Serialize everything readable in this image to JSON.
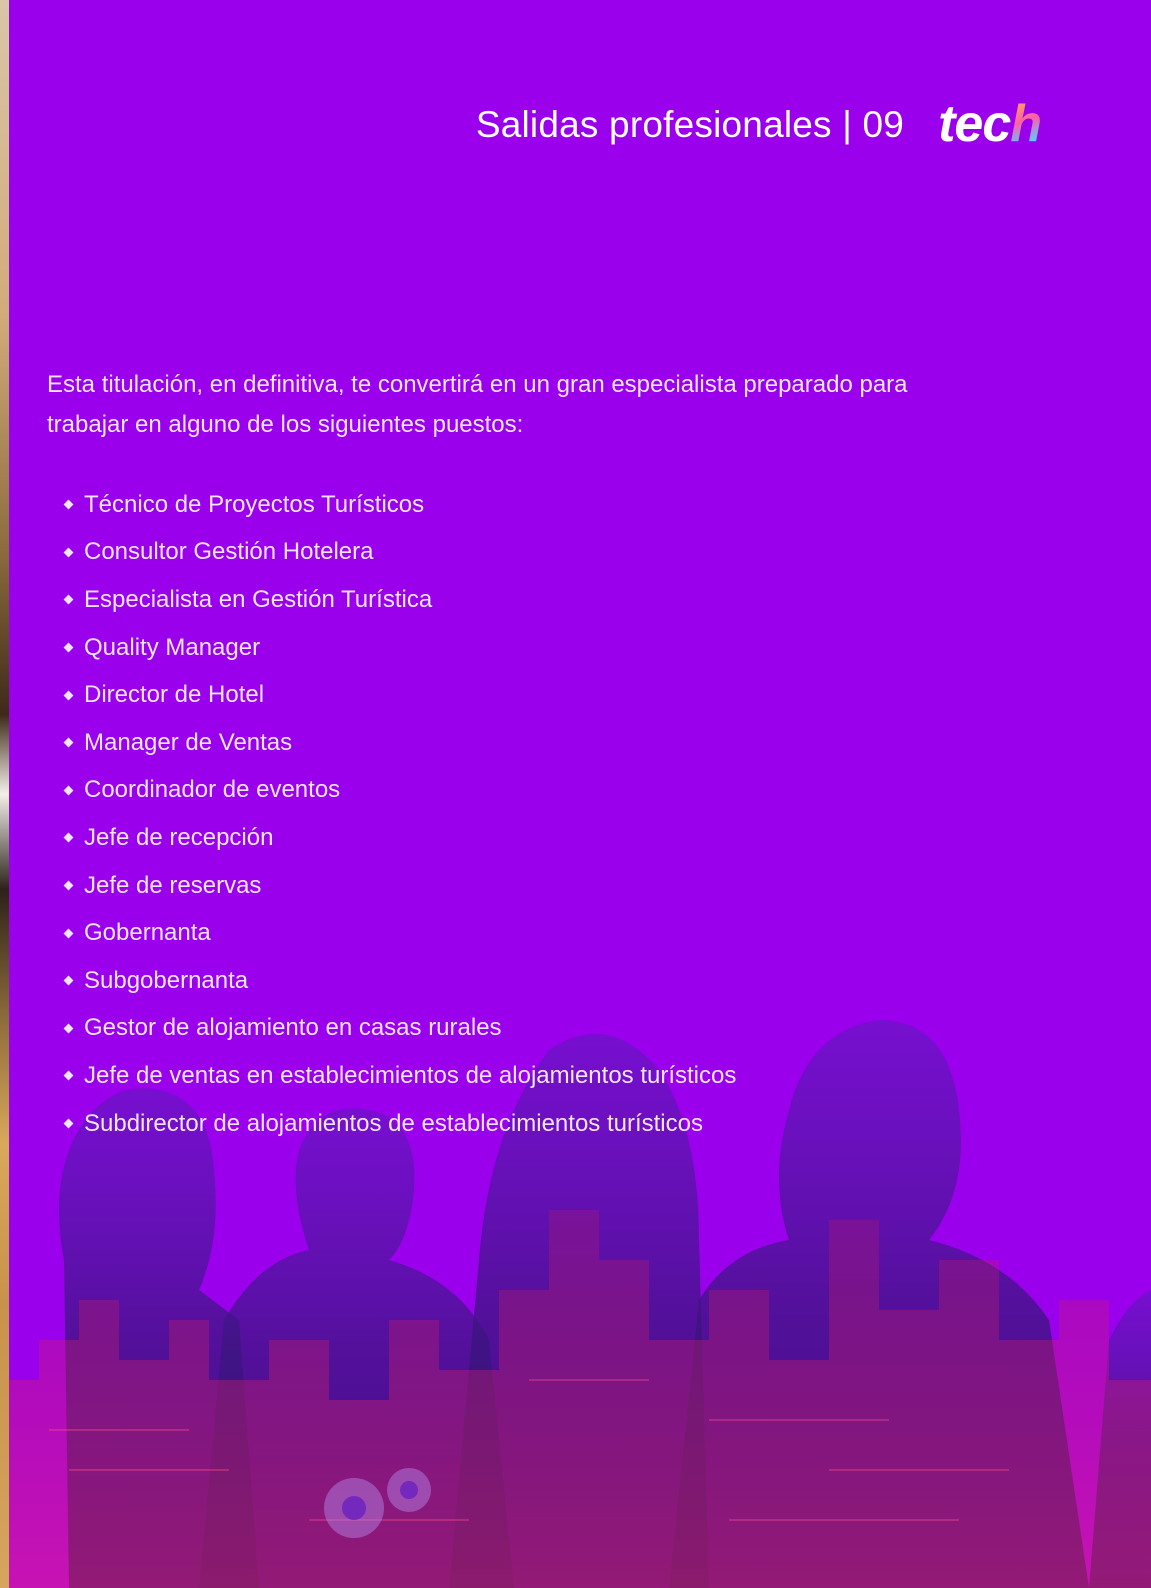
{
  "header": {
    "title": "Salidas profesionales | 09",
    "logo_text": "tec",
    "logo_accent": "h"
  },
  "intro_text": "Esta titulación, en definitiva, te convertirá en un gran especialista preparado para trabajar en alguno de los siguientes puestos:",
  "jobs": [
    "Técnico de Proyectos Turísticos",
    "Consultor Gestión Hotelera",
    "Especialista en Gestión Turística",
    "Quality Manager",
    "Director de Hotel",
    "Manager de Ventas",
    "Coordinador de eventos",
    "Jefe de recepción",
    "Jefe de reservas",
    "Gobernanta",
    "Subgobernanta",
    "Gestor de alojamiento en casas rurales",
    "Jefe de ventas en establecimientos de alojamientos turísticos",
    "Subdirector de alojamientos de establecimientos turísticos"
  ],
  "colors": {
    "background": "#9a00ec",
    "text": "#f1e4ff",
    "silhouette": "#4a1a9a"
  }
}
